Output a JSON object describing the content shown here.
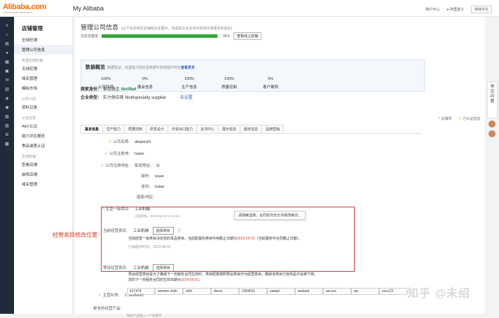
{
  "topbar": {
    "logo": "Alibaba.com",
    "logo_tag": "Global trade starts here",
    "title": "My Alibaba",
    "account_center": "账户中心",
    "username": "阿里盒子",
    "language": "简体中文"
  },
  "sidebar": {
    "header": "店铺管理",
    "items": [
      {
        "type": "item",
        "label": "全球旺铺"
      },
      {
        "type": "item",
        "label": "管理公司信息",
        "active": true
      },
      {
        "type": "group",
        "label": "管理全球旺铺"
      },
      {
        "type": "item",
        "label": "无线旺铺"
      },
      {
        "type": "item",
        "label": "域名管理"
      },
      {
        "type": "item",
        "label": "模板市场"
      },
      {
        "type": "group",
        "label": "公司介绍"
      },
      {
        "type": "item",
        "label": "资料记录"
      },
      {
        "type": "group",
        "label": "认证信息"
      },
      {
        "type": "item",
        "label": "A&V认证"
      },
      {
        "type": "item",
        "label": "能力评估报告"
      },
      {
        "type": "item",
        "label": "食品诚意认证"
      },
      {
        "type": "group",
        "label": "全球旺铺"
      },
      {
        "type": "item",
        "label": "查看店铺"
      },
      {
        "type": "item",
        "label": "装修店铺"
      },
      {
        "type": "item",
        "label": "域名管理"
      }
    ]
  },
  "header": {
    "title": "管理公司信息",
    "subtitle": "(以下信息将在店铺和企业展示，完善的企业信息可获得买家更多的信任)",
    "completeness_label": "信息完整度",
    "completeness_value": 0.98,
    "completeness_text": "98%",
    "view_shop_button": "查看线上店铺"
  },
  "overview": {
    "title": "数据概览",
    "desc": "数据验证，完善能力的完善数据可有效提升转化",
    "link": "查看更多",
    "stats": [
      {
        "value": "100%",
        "label": "公司环境"
      },
      {
        "value": "0%",
        "label": "展会信息"
      },
      {
        "value": "100%",
        "label": "生产信息"
      },
      {
        "value": "100%",
        "label": "质量控制"
      },
      {
        "value": "0%",
        "label": "客户案例"
      }
    ]
  },
  "biz": {
    "identity_label": "商家身份：",
    "identity_value": "食品诚企",
    "verified": "Verified",
    "type_label": "企业类型：",
    "type_value": "实力供应商",
    "type_en": "Multispecialty supplier",
    "type_link": "去设置"
  },
  "legend": {
    "required": "* 必填项",
    "verified": "已认证信息"
  },
  "tabs": [
    "基本信息",
    "生产能力",
    "质量控制",
    "研发设计",
    "外贸出口能力",
    "证书中心",
    "展示信息",
    "服务信息",
    "品牌营销"
  ],
  "form": {
    "company_name_label": "公司名称:",
    "company_name_value": "alisjkes01",
    "reg_place_label": "公司注册地:",
    "reg_place_value": "hubei",
    "reg_addr_label": "公司注册地址:",
    "street_label": "街道地址:",
    "street_value": "11",
    "city_label": "城市:",
    "city_value": "wuan",
    "province_label": "省份:",
    "province_value": "hubei",
    "country_label": "国家/地区:",
    "main_category_label": "* 主营一级类目:",
    "main_category_value": "工业机械",
    "main_category_note": "已由审核，2023-05-03 11:23:48",
    "tooltip": "请搜索选择，合同年内仅允许修改两次。",
    "current_cat_label": "当前经营类目:",
    "current_cat_value": "工业机械",
    "select_button": "选择类目",
    "current_desc_1": "当前经营一级类目决定您的发品类目，当前配置的类目可用截止日期为",
    "current_desc_date": "2023-05-01",
    "current_desc_2": "（当前服务中合同截止日期）。",
    "current_note": "已由服务时间：2023-05-03",
    "pre_cat_label": "预设经营类目:",
    "pre_cat_value": "工业机械",
    "pre_desc_1": "预设经营类目是为了确保下一份服务合同生效时，类目配置按照预设类目作为经营类目，确保该类目已有商品不会被下架。",
    "pre_desc_2": "您的下一份服务合同的生效日期为",
    "pre_desc_date": "2024-05-01",
    "pre_desc_end": "。",
    "main_business_label": "主营业务:",
    "main_business_value": "1. asdfasfd",
    "more_products_label": "更多的经营产品:",
    "more_products_note": "每类产品输入一个关键字",
    "product_tags": [
      "417474",
      "women cloth",
      "shirt",
      "dress",
      "2354611",
      "sadad",
      "asdasd",
      "asczxc",
      "qrt",
      "zxczZX"
    ]
  },
  "annotation": "经营类目修改位置",
  "float_widget": [
    "常",
    "见",
    "问",
    "题"
  ],
  "watermark": "知乎 @未绍",
  "colors": {
    "accent_orange": "#ff6a00",
    "progress_green": "#36a53a",
    "annotation_red": "#d03b3b",
    "nav_dark": "#1f2a3a",
    "verified_green": "#1c7a3e"
  }
}
